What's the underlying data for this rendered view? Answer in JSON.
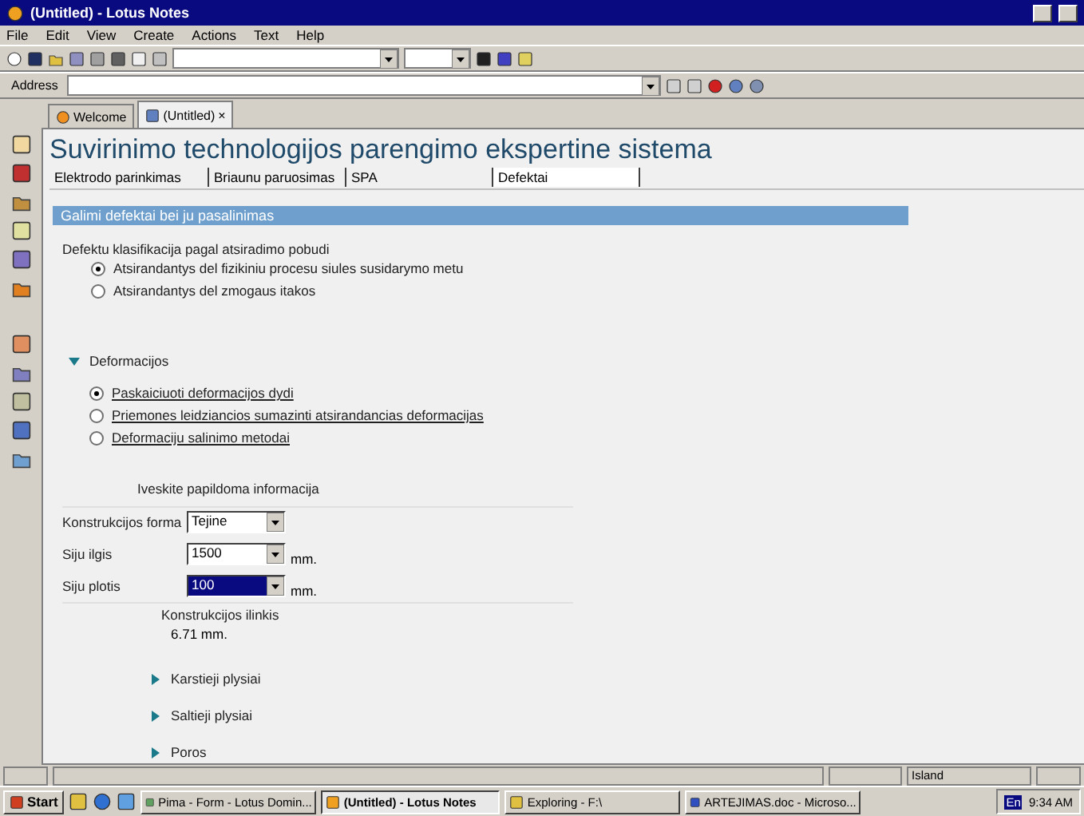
{
  "window": {
    "title": "(Untitled) - Lotus Notes"
  },
  "menu": [
    "File",
    "Edit",
    "View",
    "Create",
    "Actions",
    "Text",
    "Help"
  ],
  "address": {
    "label": "Address"
  },
  "doc_tabs": [
    {
      "label": "Welcome",
      "selected": false,
      "closable": false
    },
    {
      "label": "(Untitled)",
      "selected": true,
      "closable": true,
      "close": "×"
    }
  ],
  "page": {
    "title": "Suvirinimo technologijos parengimo ekspertine sistema",
    "tabs": [
      {
        "label": "Elektrodo parinkimas",
        "selected": false
      },
      {
        "label": "Briaunu paruosimas",
        "selected": false
      },
      {
        "label": "SPA",
        "selected": false
      },
      {
        "label": "Defektai",
        "selected": true
      }
    ],
    "section_title": "Galimi defektai bei ju pasalinimas",
    "classification": {
      "label": "Defektu klasifikacija pagal atsiradimo pobudi",
      "options": [
        {
          "label": "Atsirandantys del fizikiniu procesu siules susidarymo metu",
          "selected": true
        },
        {
          "label": "Atsirandantys del zmogaus itakos",
          "selected": false
        }
      ]
    },
    "deformations": {
      "label": "Deformacijos",
      "expanded": true,
      "options": [
        {
          "label": "Paskaiciuoti deformacijos dydi",
          "selected": true
        },
        {
          "label": "Priemones leidziancios sumazinti atsirandancias deformacijas",
          "selected": false
        },
        {
          "label": "Deformaciju salinimo metodai",
          "selected": false
        }
      ]
    },
    "extra": {
      "label": "Iveskite papildoma informacija",
      "fields": [
        {
          "label": "Konstrukcijos forma",
          "value": "Tejine",
          "focused": false
        },
        {
          "label": "Siju ilgis",
          "value": "1500",
          "unit": "mm.",
          "focused": false
        },
        {
          "label": "Siju plotis",
          "value": "100",
          "unit": "mm.",
          "focused": true
        }
      ],
      "result": {
        "label": "Konstrukcijos ilinkis",
        "value": "6.71",
        "unit": "mm."
      }
    },
    "sections": [
      {
        "label": "Karstieji plysiai",
        "expanded": false
      },
      {
        "label": "Saltieji plysiai",
        "expanded": false
      },
      {
        "label": "Poros",
        "expanded": false
      }
    ]
  },
  "status_bar": {
    "location": "Island"
  },
  "taskbar": {
    "start": "Start",
    "tasks": [
      {
        "label": "Pima - Form - Lotus Domin...",
        "selected": false
      },
      {
        "label": "(Untitled) - Lotus Notes",
        "selected": true
      },
      {
        "label": "Exploring - F:\\",
        "selected": false
      },
      {
        "label": "ARTEJIMAS.doc - Microso...",
        "selected": false
      }
    ],
    "language": "En",
    "clock": "9:34 AM"
  }
}
